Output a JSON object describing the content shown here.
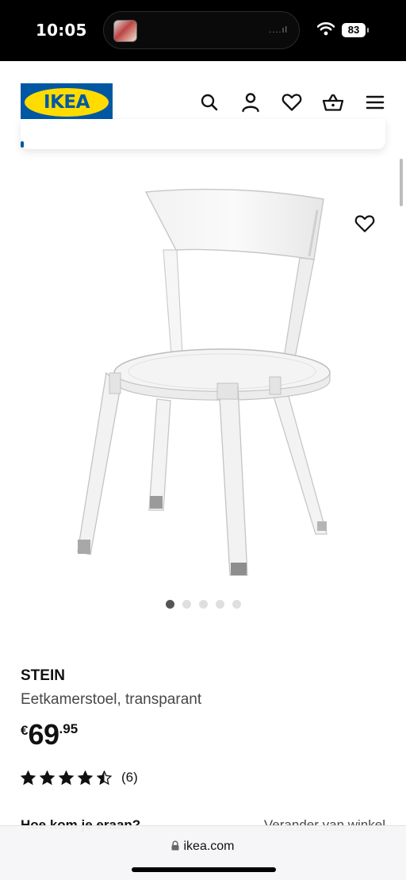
{
  "status_bar": {
    "time": "10:05",
    "battery": "83",
    "signal_dots": "....ıl"
  },
  "header": {
    "logo_text": "IKEA",
    "icons": [
      "search-icon",
      "account-icon",
      "heart-icon",
      "basket-icon",
      "menu-icon"
    ]
  },
  "product": {
    "name": "STEIN",
    "description": "Eetkamerstoel, transparant",
    "price": {
      "currency": "€",
      "integer": "69",
      "decimals": ".95"
    },
    "rating": {
      "value": 4.5,
      "max": 5,
      "count_label": "(6)"
    },
    "image_pager": {
      "total": 5,
      "active": 1
    }
  },
  "delivery": {
    "question": "Hoe kom je eraan?",
    "change_store": "Verander van winkel"
  },
  "browser": {
    "url": "ikea.com"
  },
  "colors": {
    "ikea_blue": "#0058a3",
    "ikea_yellow": "#ffdb00"
  }
}
